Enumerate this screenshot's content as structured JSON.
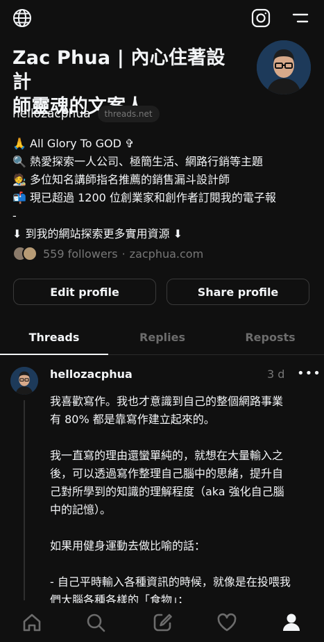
{
  "topbar": {
    "globe_icon": "globe-icon",
    "instagram_icon": "instagram-icon",
    "menu_icon": "menu-icon"
  },
  "profile": {
    "name_line1": "Zac Phua | 內心住著設計",
    "name_line2": "師靈魂的文案人",
    "handle": "hellozacphua",
    "badge": "threads.net",
    "bio": [
      "🙏 All Glory To GOD ✞",
      "🔍 熱愛探索一人公司、極簡生活、網路行銷等主題",
      "🧑‍🎨 多位知名講師指名推薦的銷售漏斗設計師",
      "📬 現已超過 1200 位創業家和創作者訂閱我的電子報",
      "-",
      "⬇ 到我的網站探索更多實用資源 ⬇"
    ],
    "followers": "559 followers",
    "separator": "·",
    "website": "zacphua.com"
  },
  "buttons": {
    "edit": "Edit profile",
    "share": "Share profile"
  },
  "tabs": {
    "threads": "Threads",
    "replies": "Replies",
    "reposts": "Reposts"
  },
  "post": {
    "user": "hellozacphua",
    "time": "3 d",
    "more": "•••",
    "lines": [
      "我喜歡寫作。我也才意識到自己的整個網路事業",
      "有 80% 都是靠寫作建立起來的。",
      "",
      "我一直寫的理由還蠻單純的，就想在大量輸入之",
      "後，可以透過寫作整理自己腦中的思緒，提升自",
      "己對所學到的知識的理解程度（aka 強化自己腦",
      "中的記憶）。",
      "",
      "如果用健身運動去做比喻的話：",
      "",
      "- 自己平時輸入各種資訊的時候，就像是在投喂我",
      "們大腦各種各樣的「食物」；"
    ]
  },
  "navbar": [
    "home-icon",
    "search-icon",
    "compose-icon",
    "heart-icon",
    "profile-icon"
  ]
}
